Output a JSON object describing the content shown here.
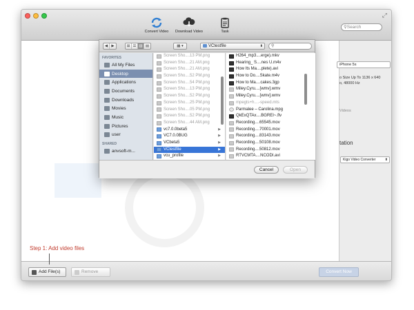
{
  "toolbar": {
    "convert_video": "Convert Video",
    "download_video": "Download Video",
    "task": "Task",
    "search_placeholder": "Search"
  },
  "right_panel": {
    "device_field": "iPhone 5s",
    "info_line1": "o Size Up To 1136 x 640",
    "info_line2": "o, 48000 Hz",
    "videos_label": "Videos",
    "section_label": "tation",
    "output_select": "Kigo Video Converter"
  },
  "step": {
    "prefix": "Step 1:",
    "text": "Add video files"
  },
  "bottom": {
    "add_files": "Add File(s)",
    "remove": "Remove",
    "convert_now": "Convert Now"
  },
  "dialog": {
    "current_folder": "VCtestfile",
    "sidebar": {
      "favorites_heading": "FAVORITES",
      "shared_heading": "SHARED",
      "favorites": [
        {
          "label": "All My Files",
          "icon": "all-files-icon"
        },
        {
          "label": "Desktop",
          "icon": "desktop-icon",
          "selected": true
        },
        {
          "label": "Applications",
          "icon": "applications-icon"
        },
        {
          "label": "Documents",
          "icon": "documents-icon"
        },
        {
          "label": "Downloads",
          "icon": "downloads-icon"
        },
        {
          "label": "Movies",
          "icon": "movies-icon"
        },
        {
          "label": "Music",
          "icon": "music-icon"
        },
        {
          "label": "Pictures",
          "icon": "pictures-icon"
        },
        {
          "label": "user",
          "icon": "home-icon"
        }
      ],
      "shared": [
        {
          "label": "anvsoft-m...",
          "icon": "computer-icon"
        }
      ]
    },
    "column1": [
      {
        "label": "Screen Sho....13 PM.png",
        "kind": "dim"
      },
      {
        "label": "Screen Sho....21 AM.png",
        "kind": "dim"
      },
      {
        "label": "Screen Sho....21 AM.png",
        "kind": "dim"
      },
      {
        "label": "Screen Sho....52 PM.png",
        "kind": "dim"
      },
      {
        "label": "Screen Sho....54 PM.png",
        "kind": "dim"
      },
      {
        "label": "Screen Sho....13 PM.png",
        "kind": "dim"
      },
      {
        "label": "Screen Sho....52 PM.png",
        "kind": "dim"
      },
      {
        "label": "Screen Sho....25 PM.png",
        "kind": "dim"
      },
      {
        "label": "Screen Sho....05 PM.png",
        "kind": "dim"
      },
      {
        "label": "Screen Sho....52 PM.png",
        "kind": "dim"
      },
      {
        "label": "Screen Sho....44 AM.png",
        "kind": "dim"
      },
      {
        "label": "vc7.0.0beta5",
        "kind": "folder"
      },
      {
        "label": "VC7.0.0BUG",
        "kind": "folder"
      },
      {
        "label": "VCbeta5",
        "kind": "folder"
      },
      {
        "label": "VCtestfile",
        "kind": "folder",
        "selected": true
      },
      {
        "label": "vcu_profile",
        "kind": "folder"
      }
    ],
    "column2": [
      {
        "label": "H264_mp3....erge).mkv",
        "kind": "video"
      },
      {
        "label": "Hearing_ S....nes U.m4v",
        "kind": "video"
      },
      {
        "label": "How Its Ma....plete).avi",
        "kind": "video"
      },
      {
        "label": "How to Do....Skate.m4v",
        "kind": "video"
      },
      {
        "label": "How to Ma....cakes.3gp",
        "kind": "video"
      },
      {
        "label": "Miley.Cyru....[wmv].wmv",
        "kind": "file"
      },
      {
        "label": "Miley.Cyru....[wmv].wmv",
        "kind": "file"
      },
      {
        "label": "mpegts+h....-speed.mts",
        "kind": "dim"
      },
      {
        "label": "Parmalee – Carolina.mpg",
        "kind": "audio"
      },
      {
        "label": "QkExQTAx....BGREI~.flv",
        "kind": "video"
      },
      {
        "label": "Recording....65545.mov",
        "kind": "file"
      },
      {
        "label": "Recording....70001.mov",
        "kind": "file"
      },
      {
        "label": "Recording....83143.mov",
        "kind": "file"
      },
      {
        "label": "Recording....50108.mov",
        "kind": "file"
      },
      {
        "label": "Recording....50812.mov",
        "kind": "file"
      },
      {
        "label": "RTVCMTA....NCODI.avi",
        "kind": "file"
      }
    ],
    "cancel": "Cancel",
    "open": "Open"
  }
}
